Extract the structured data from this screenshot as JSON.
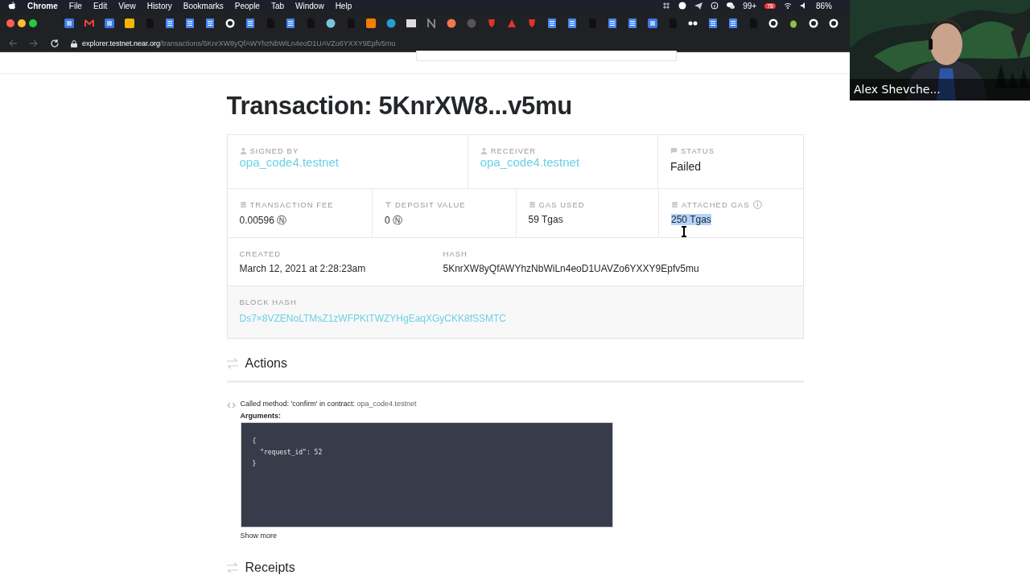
{
  "menu_bar": {
    "app": "Chrome",
    "items": [
      "File",
      "Edit",
      "View",
      "History",
      "Bookmarks",
      "People",
      "Tab",
      "Window",
      "Help"
    ],
    "notification_count": "99+",
    "badge": "78",
    "battery": "86%"
  },
  "address_bar": {
    "host": "explorer.testnet.near.org",
    "path": "/transactions/5KnrXW8yQfAWYhzNbWiLn4eoD1UAVZo6YXXY9Epfv5mu"
  },
  "video_tile": {
    "name": "Alex Shevche..."
  },
  "page_title": "Transaction: 5KnrXW8...v5mu",
  "summary": [
    {
      "label": "SIGNED BY",
      "value": "opa_code4.testnet",
      "kind": "link"
    },
    {
      "label": "RECEIVER",
      "value": "opa_code4.testnet",
      "kind": "link"
    },
    {
      "label": "STATUS",
      "value": "Failed",
      "kind": "text"
    }
  ],
  "metrics": [
    {
      "label": "TRANSACTION FEE",
      "value": "0.00596",
      "unit": "Ⓝ",
      "info": false,
      "selected": false
    },
    {
      "label": "DEPOSIT VALUE",
      "value": "0",
      "unit": "Ⓝ",
      "info": false,
      "selected": false
    },
    {
      "label": "GAS USED",
      "value": "59 Tgas",
      "info": false,
      "selected": false
    },
    {
      "label": "ATTACHED GAS",
      "value": "250 Tgas",
      "info": true,
      "selected": true
    }
  ],
  "created": {
    "label": "CREATED",
    "value": "March 12, 2021 at 2:28:23am"
  },
  "hash": {
    "label": "HASH",
    "value": "5KnrXW8yQfAWYhzNbWiLn4eoD1UAVZo6YXXY9Epfv5mu"
  },
  "block_hash": {
    "label": "BLOCK HASH",
    "value": "Ds7×8VZENoLTMsZ1zWFPKtTWZYHgEaqXGyCKK8fSSMTC"
  },
  "actions": {
    "title": "Actions",
    "call_text": "Called method: 'confirm' in contract:",
    "contract": "opa_code4.testnet",
    "arguments_label": "Arguments:",
    "arguments_code": "{\n  \"request_id\": 52\n}",
    "show_more": "Show more"
  },
  "receipts": {
    "title": "Receipts"
  }
}
